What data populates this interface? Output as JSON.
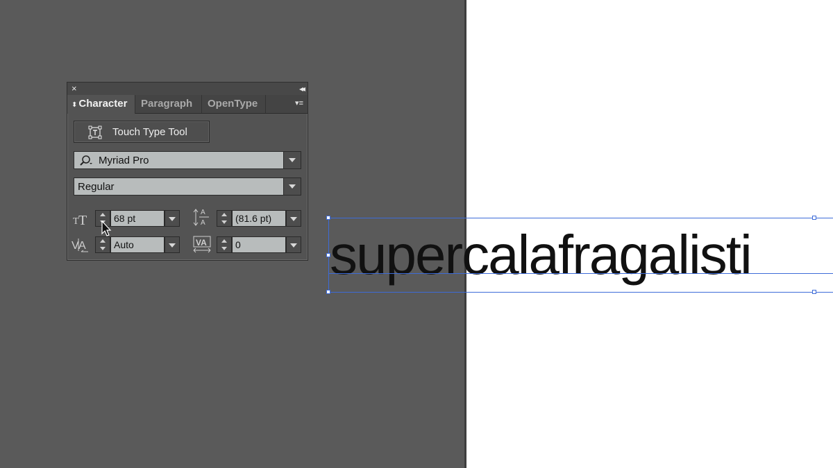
{
  "panel": {
    "close": "×",
    "collapse": "◂◂",
    "tabs": [
      {
        "label": "Character",
        "active": true
      },
      {
        "label": "Paragraph",
        "active": false
      },
      {
        "label": "OpenType",
        "active": false
      }
    ],
    "menu_icon": "panel-menu-icon"
  },
  "touch_tool": {
    "label": "Touch Type Tool"
  },
  "font_family": {
    "value": "Myriad Pro"
  },
  "font_style": {
    "value": "Regular"
  },
  "font_size": {
    "value": "68 pt"
  },
  "leading": {
    "value": "(81.6 pt)"
  },
  "kerning": {
    "value": "Auto"
  },
  "tracking": {
    "value": "0"
  },
  "canvas": {
    "text": "supercalafragalisti",
    "colors": {
      "selection": "#3d6bd8",
      "pasteboard": "#5a5a5a",
      "artboard": "#ffffff"
    }
  }
}
